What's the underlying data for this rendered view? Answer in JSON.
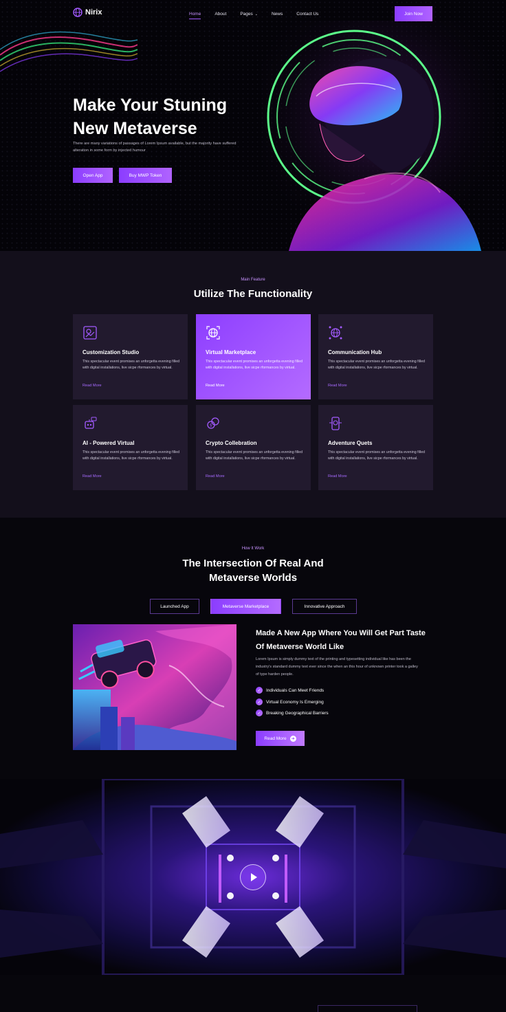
{
  "nav": {
    "logo": "Nirix",
    "links": [
      {
        "label": "Home",
        "active": true
      },
      {
        "label": "About",
        "active": false
      },
      {
        "label": "Pages",
        "active": false,
        "dropdown": true
      },
      {
        "label": "News",
        "active": false
      },
      {
        "label": "Contact Us",
        "active": false
      }
    ],
    "cta": "Join Now"
  },
  "hero": {
    "title": "Make Your Stuning New Metaverse",
    "subtitle": "There are many variations of passages of Lorem Ipsum available, but the majority have suffered alteration in some form by injected humour",
    "buttons": [
      "Open App",
      "Buy MWP Token"
    ]
  },
  "features": {
    "kicker": "Main Feature",
    "title": "Utilize The Functionality",
    "cards": [
      {
        "title": "Customization Studio",
        "text": "This spectacular event promises an unforgetta evening filled with digital installations, live sicpe rformances by virtual.",
        "link": "Read More",
        "icon": "customization-icon",
        "highlight": false
      },
      {
        "title": "Virtual Marketplace",
        "text": "This spectacular event promises an unforgetta evening filled with digital installations, live sicpe rformances by virtual.",
        "link": "Read More",
        "icon": "globe-icon",
        "highlight": true
      },
      {
        "title": "Communication Hub",
        "text": "This spectacular event promises an unforgetta evening filled with digital installations, live sicpe rformances by virtual.",
        "link": "Read More",
        "icon": "network-globe-icon",
        "highlight": false
      },
      {
        "title": "AI - Powered Virtual",
        "text": "This spectacular event promises an unforgetta evening filled with digital installations, live sicpe rformances by virtual.",
        "link": "Read More",
        "icon": "ai-robot-icon",
        "highlight": false
      },
      {
        "title": "Crypto Collebration",
        "text": "This spectacular event promises an unforgetta evening filled with digital installations, live sicpe rformances by virtual.",
        "link": "Read More",
        "icon": "crypto-coins-icon",
        "highlight": false
      },
      {
        "title": "Adventure Quets",
        "text": "This spectacular event promises an unforgetta evening filled with digital installations, live sicpe rformances by virtual.",
        "link": "Read More",
        "icon": "adventure-device-icon",
        "highlight": false
      }
    ]
  },
  "how": {
    "kicker": "How It Work",
    "title_line1": "The Intersection Of Real And",
    "title_line2": "Metaverse Worlds",
    "tabs": [
      {
        "label": "Launched App",
        "active": false
      },
      {
        "label": "Metaverse Marketplace",
        "active": true
      },
      {
        "label": "Innovative Approach",
        "active": false
      }
    ],
    "heading": "Made A New App Where You Will Get Part Taste Of Metaverse World Like",
    "text": "Lorem Ipsum is simply dummy text of the printing and typesetting individual like has been the industry's standard dummy text ever since the when an this hour of unknown printer took a galley of type harden people.",
    "checks": [
      "Individuals Can Meet Friends",
      "Virtual Economy Is Emerging",
      "Breaking Geographical Barriers"
    ],
    "button": "Read More"
  },
  "colors": {
    "accent": "#8b3dff",
    "accent_light": "#b46bff",
    "card_bg": "#221a2e",
    "section_bg": "#130f1b"
  }
}
